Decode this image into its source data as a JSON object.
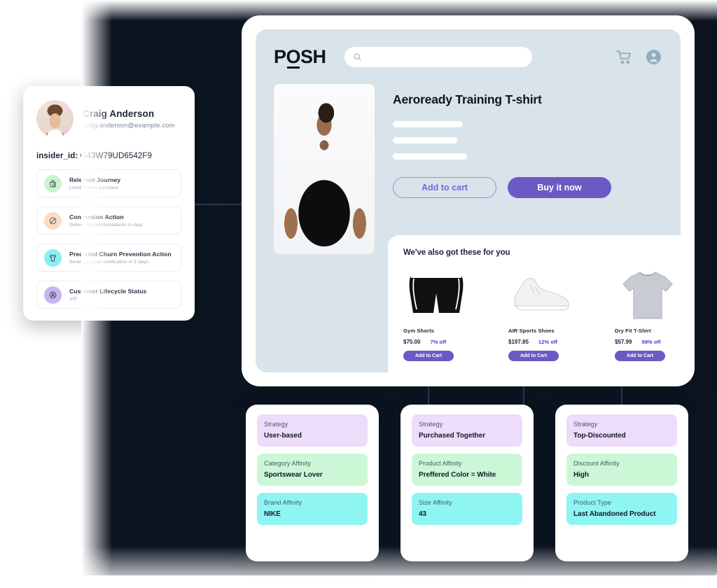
{
  "colors": {
    "backdrop": "#0c1420",
    "shop_bg": "#d8e3ea",
    "accent_purple": "#6c5ac4",
    "discount_blue": "#4b35e8",
    "strategy_lilac": "#eedcfb",
    "affinity_mint": "#ccf7d6",
    "affinity_cyan": "#8ff5f2",
    "connector": "#2c3e52"
  },
  "profile": {
    "name": "Craig Anderson",
    "email": "craig.anderson@example.com",
    "insider_id_label": "insider_id:",
    "insider_id_value": "G43W79UD6542F9",
    "journey_cards": [
      {
        "title": "Relevant Journey",
        "subtitle": "Likelihood to purchase",
        "icon": "bag-icon",
        "icon_bg": "#caf3d0",
        "icon_color": "#4c5a63"
      },
      {
        "title": "Conversion Action",
        "subtitle": "Deliver Recommendations In-App",
        "icon": "no-discount-icon",
        "icon_bg": "#fbdcc6",
        "icon_color": "#4c5a63"
      },
      {
        "title": "Predicted Churn Prevention Action",
        "subtitle": "Send app push notification in 3 days",
        "icon": "shirt-icon",
        "icon_bg": "#8ceef2",
        "icon_color": "#35474f"
      },
      {
        "title": "Customer Lifecycle Status",
        "subtitle": "VIP",
        "icon": "user-target-icon",
        "icon_bg": "#c6b5ef",
        "icon_color": "#3f3a56"
      }
    ]
  },
  "shop": {
    "logo": {
      "part1": "P",
      "part2": "O",
      "part3": "SH"
    },
    "search_placeholder": "",
    "search_value": "",
    "icons": {
      "search": "search-icon",
      "cart": "cart-icon",
      "account": "account-icon"
    },
    "product": {
      "title": "Aeroready Training T-shirt",
      "image_alt": "male-model-black-tshirt",
      "add_to_cart_label": "Add to cart",
      "buy_now_label": "Buy it now"
    },
    "recommendations": {
      "heading": "We've also got these for you",
      "items": [
        {
          "name": "Gym Shorts",
          "price": "$75.00",
          "discount": "7% off",
          "button": "Add to Cart",
          "image": "black-gym-shorts"
        },
        {
          "name": "AIR Sports Shoes",
          "price": "$197.85",
          "discount": "12% off",
          "button": "Add to Cart",
          "image": "white-sneaker"
        },
        {
          "name": "Dry Fit T-Shirt",
          "price": "$57.99",
          "discount": "59% off",
          "button": "Add to Cart",
          "image": "grey-tshirt"
        }
      ]
    }
  },
  "strategy_panels": [
    {
      "blocks": [
        {
          "label": "Strategy",
          "value": "User-based",
          "bg": "#eedcfb"
        },
        {
          "label": "Category Affinity",
          "value": "Sportswear Lover",
          "bg": "#ccf7d6"
        },
        {
          "label": "Brand Affinity",
          "value": "NIKE",
          "bg": "#8ff5f2"
        }
      ]
    },
    {
      "blocks": [
        {
          "label": "Strategy",
          "value": "Purchased Together",
          "bg": "#eedcfb"
        },
        {
          "label": "Product Affinity",
          "value": "Preffered Color = White",
          "bg": "#ccf7d6"
        },
        {
          "label": "Size Affinity",
          "value": "43",
          "bg": "#8ff5f2"
        }
      ]
    },
    {
      "blocks": [
        {
          "label": "Strategy",
          "value": "Top-Discounted",
          "bg": "#eedcfb"
        },
        {
          "label": "Discount Affinity",
          "value": "High",
          "bg": "#ccf7d6"
        },
        {
          "label": "Product Type",
          "value": "Last Abandoned Product",
          "bg": "#8ff5f2"
        }
      ]
    }
  ]
}
